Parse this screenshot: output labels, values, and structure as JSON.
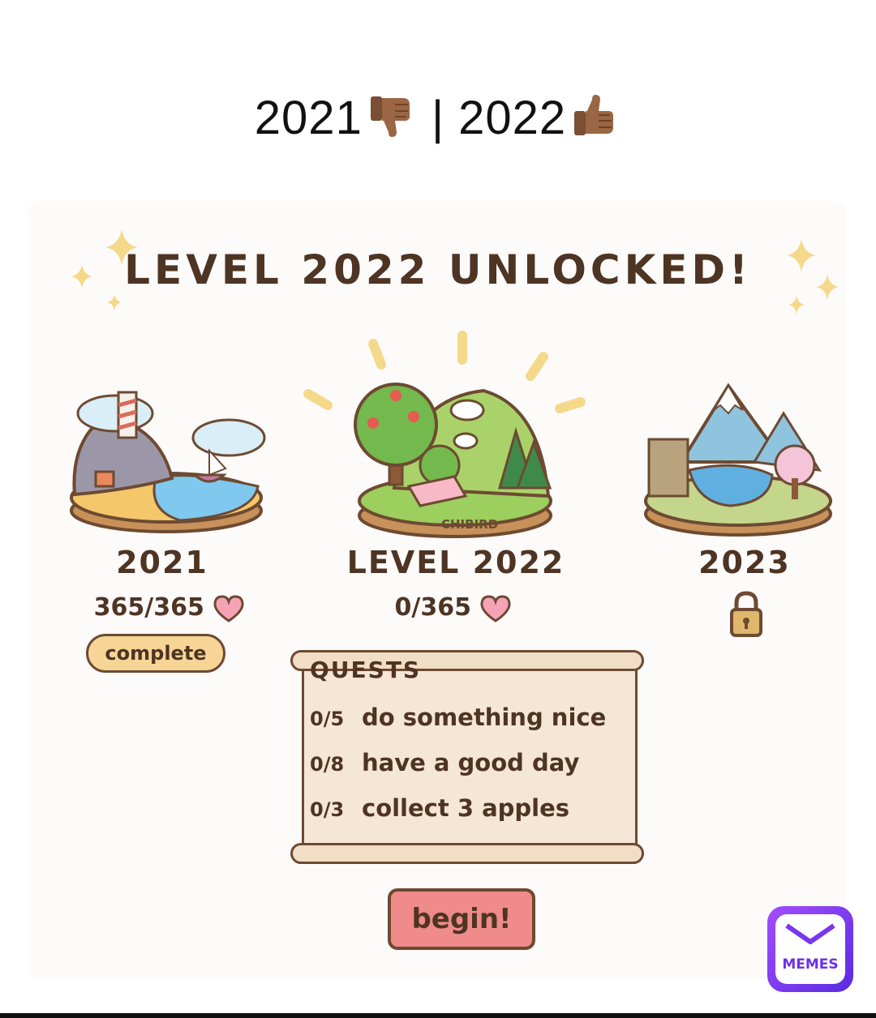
{
  "caption": {
    "year_left": "2021",
    "separator": "|",
    "year_right": "2022",
    "left_emoji": "thumbs-down-medium-dark-skin",
    "right_emoji": "thumbs-up-medium-dark-skin",
    "skin_color": "#9a6644"
  },
  "headline": "LEVEL 2022 UNLOCKED!",
  "islands": [
    {
      "label": "2021",
      "progress_text": "365/365",
      "status": "complete",
      "icon": "heart-icon"
    },
    {
      "label": "LEVEL 2022",
      "progress_text": "0/365",
      "icon": "heart-icon",
      "watermark": "CHIBIRD"
    },
    {
      "label": "2023",
      "icon": "lock-icon"
    }
  ],
  "quests": {
    "title": "QUESTS",
    "items": [
      {
        "count": "0/5",
        "text": "do something nice"
      },
      {
        "count": "0/8",
        "text": "have a good day"
      },
      {
        "count": "0/3",
        "text": "collect 3 apples"
      }
    ]
  },
  "begin_label": "begin!",
  "watermark_badge": "MEMES",
  "colors": {
    "ink": "#4e3423",
    "heart": "#f5a3b5",
    "accent_pink": "#ef8b8b",
    "scroll": "#f6e6d6",
    "badge": "#f6d596"
  }
}
